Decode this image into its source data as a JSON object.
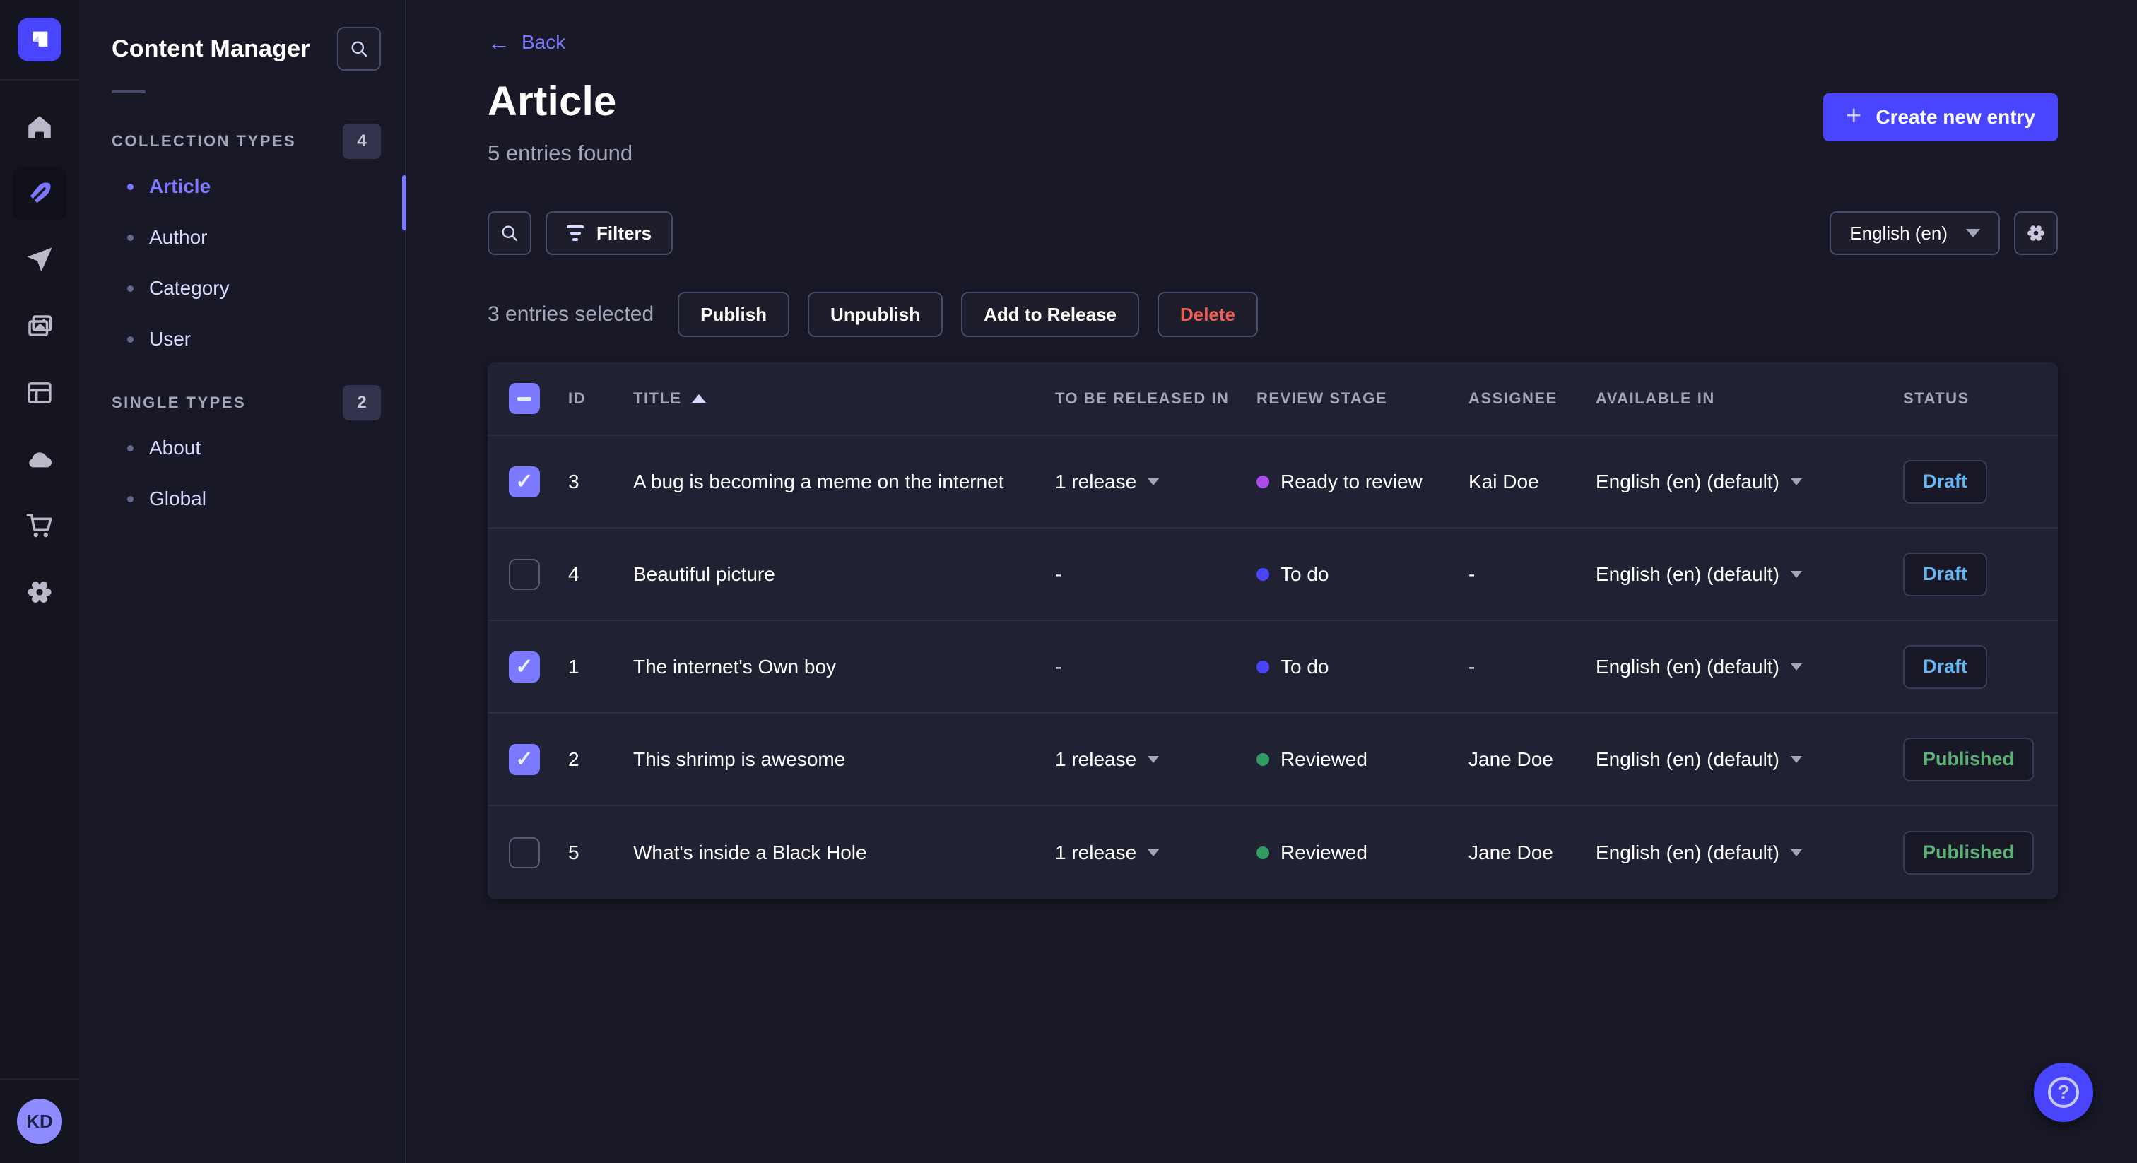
{
  "brand": {
    "logo_icon": "strapi-logo-icon"
  },
  "sidebar": {
    "icons": [
      {
        "name": "home-icon"
      },
      {
        "name": "content-manager-icon",
        "active": true
      },
      {
        "name": "send-icon"
      },
      {
        "name": "media-library-icon"
      },
      {
        "name": "content-type-builder-icon"
      },
      {
        "name": "cloud-icon"
      },
      {
        "name": "marketplace-icon"
      },
      {
        "name": "settings-icon"
      }
    ],
    "avatar_initials": "KD"
  },
  "panel": {
    "title": "Content Manager",
    "sections": [
      {
        "label": "COLLECTION TYPES",
        "count": "4",
        "items": [
          {
            "label": "Article",
            "active": true
          },
          {
            "label": "Author",
            "active": false
          },
          {
            "label": "Category",
            "active": false
          },
          {
            "label": "User",
            "active": false
          }
        ]
      },
      {
        "label": "SINGLE TYPES",
        "count": "2",
        "items": [
          {
            "label": "About",
            "active": false
          },
          {
            "label": "Global",
            "active": false
          }
        ]
      }
    ]
  },
  "header": {
    "back_label": "Back",
    "title": "Article",
    "subtitle": "5 entries found",
    "create_label": "Create new entry"
  },
  "toolbar": {
    "filters_label": "Filters",
    "locale_value": "English (en)"
  },
  "selection": {
    "text": "3 entries selected",
    "actions": [
      {
        "label": "Publish",
        "variant": "default"
      },
      {
        "label": "Unpublish",
        "variant": "default"
      },
      {
        "label": "Add to Release",
        "variant": "default"
      },
      {
        "label": "Delete",
        "variant": "danger"
      }
    ]
  },
  "table": {
    "columns": {
      "id": "ID",
      "title": "TITLE",
      "release": "TO BE RELEASED IN",
      "review": "REVIEW STAGE",
      "assignee": "ASSIGNEE",
      "available": "AVAILABLE IN",
      "status": "STATUS"
    },
    "sorted_column": "TITLE",
    "sort_direction": "asc",
    "rows": [
      {
        "checked": true,
        "id": "3",
        "title": "A bug is becoming a meme on the internet",
        "release": "1 release",
        "review": "Ready to review",
        "review_color": "#ab4aeb",
        "assignee": "Kai Doe",
        "available": "English (en) (default)",
        "status": "Draft"
      },
      {
        "checked": false,
        "id": "4",
        "title": "Beautiful picture",
        "release": "-",
        "review": "To do",
        "review_color": "#4945ff",
        "assignee": "-",
        "available": "English (en) (default)",
        "status": "Draft"
      },
      {
        "checked": true,
        "id": "1",
        "title": "The internet's Own boy",
        "release": "-",
        "review": "To do",
        "review_color": "#4945ff",
        "assignee": "-",
        "available": "English (en) (default)",
        "status": "Draft"
      },
      {
        "checked": true,
        "id": "2",
        "title": "This shrimp is awesome",
        "release": "1 release",
        "review": "Reviewed",
        "review_color": "#2f9c62",
        "assignee": "Jane Doe",
        "available": "English (en) (default)",
        "status": "Published"
      },
      {
        "checked": false,
        "id": "5",
        "title": "What's inside a Black Hole",
        "release": "1 release",
        "review": "Reviewed",
        "review_color": "#2f9c62",
        "assignee": "Jane Doe",
        "available": "English (en) (default)",
        "status": "Published"
      }
    ]
  },
  "colors": {
    "primary": "#4945ff",
    "primary_light": "#7b79ff",
    "danger": "#ee5e52",
    "success_text": "#5cb176",
    "draft_text": "#66b7f1",
    "card_bg": "#212134",
    "app_bg": "#181826"
  }
}
